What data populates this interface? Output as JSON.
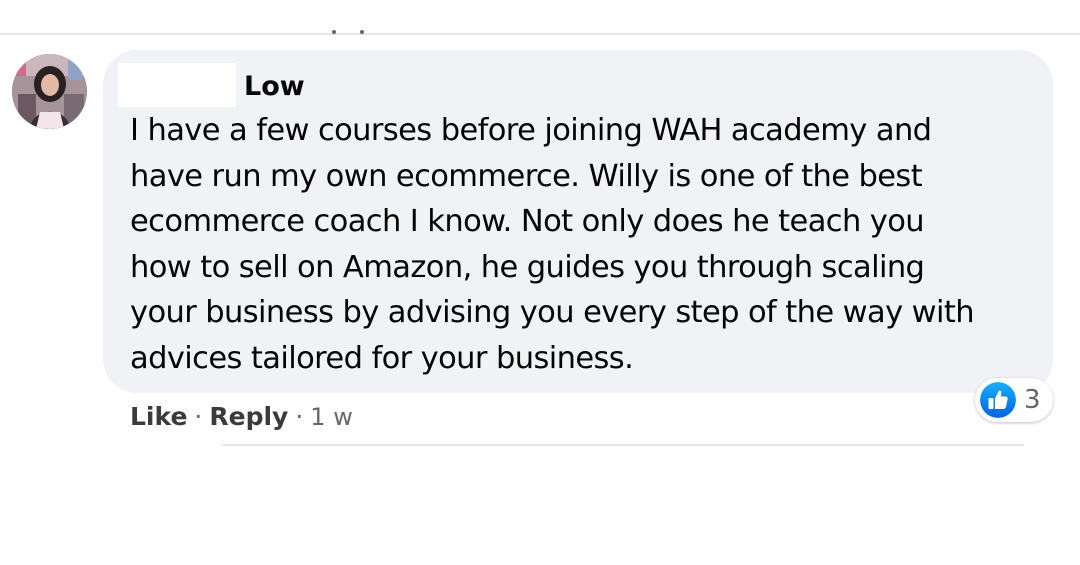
{
  "comment": {
    "author": "Low",
    "text_lines": [
      "I have a few courses before joining WAH academy and",
      "have run my own ecommerce. Willy is one of the best",
      "ecommerce coach I know. Not only does he teach you",
      "how to sell on Amazon, he guides you through scaling",
      "your business by advising you every step of the way with",
      "advices tailored for your business."
    ],
    "reactions": {
      "icon": "like-icon",
      "count": "3"
    },
    "actions": {
      "like_label": "Like",
      "separator": "·",
      "reply_label": "Reply",
      "timestamp": "1 w"
    }
  },
  "colors": {
    "bubble_background": "#f0f2f5",
    "text": "#050505",
    "secondary_text": "#65676b",
    "like_blue": "#1877f2"
  }
}
